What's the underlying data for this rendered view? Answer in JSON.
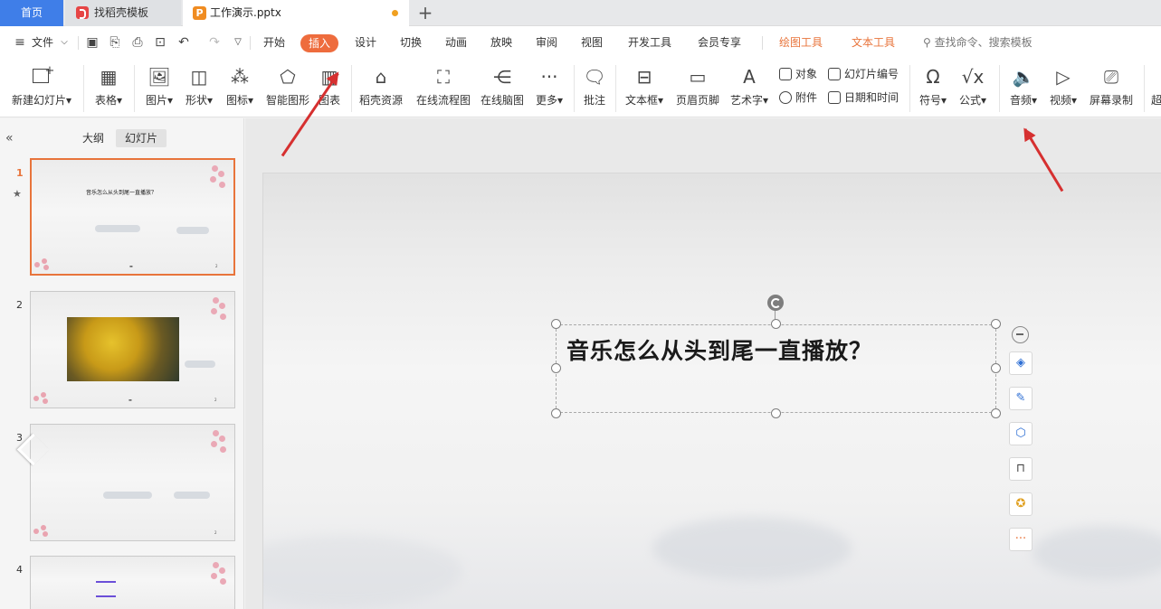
{
  "tabs": {
    "home": "首页",
    "template": "找稻壳模板",
    "document": "工作演示.pptx",
    "add": "+"
  },
  "menu": {
    "file": "文件",
    "items": [
      "开始",
      "插入",
      "设计",
      "切换",
      "动画",
      "放映",
      "审阅",
      "视图",
      "开发工具",
      "会员专享"
    ],
    "active": "插入",
    "context_tabs": [
      "绘图工具",
      "文本工具"
    ],
    "search_placeholder": "查找命令、搜索模板"
  },
  "ribbon": {
    "new_slide": "新建幻灯片",
    "table": "表格",
    "picture": "图片",
    "shape": "形状",
    "icon": "图标",
    "smart_art": "智能图形",
    "chart": "图表",
    "docer_resources": "稻壳资源",
    "online_flowchart": "在线流程图",
    "online_mindmap": "在线脑图",
    "more": "更多",
    "comment": "批注",
    "textbox": "文本框",
    "header_footer": "页眉页脚",
    "wordart": "艺术字",
    "object": "对象",
    "slide_number": "幻灯片编号",
    "attachment": "附件",
    "date_time": "日期和时间",
    "symbol": "符号",
    "formula": "公式",
    "audio": "音频",
    "video": "视频",
    "screen_record": "屏幕录制",
    "cut_label": "超"
  },
  "panel": {
    "outline_tab": "大纲",
    "slides_tab": "幻灯片",
    "slides": [
      {
        "num": "1",
        "title": "音乐怎么从头到尾一直播放？",
        "footer": "2"
      },
      {
        "num": "2",
        "footer": "2"
      },
      {
        "num": "3",
        "footer": "2"
      },
      {
        "num": "4"
      }
    ]
  },
  "slide": {
    "title": "音乐怎么从头到尾一直播放？"
  },
  "colors": {
    "accent": "#ee6c3d",
    "home_tab": "#3f7ee8",
    "annotation_arrow": "#d63030"
  }
}
